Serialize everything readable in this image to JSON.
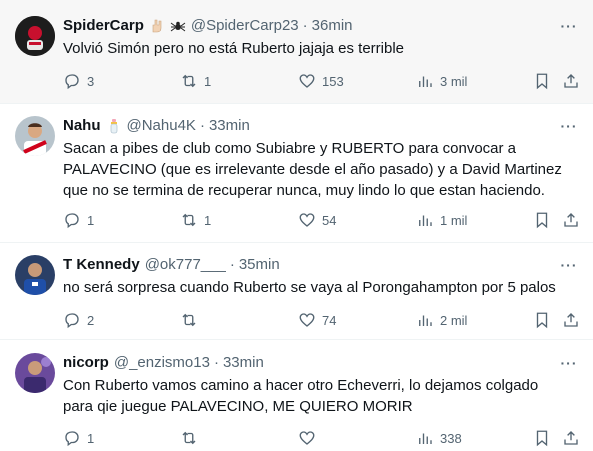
{
  "tweets": [
    {
      "name": "SpiderCarp",
      "handle": "@SpiderCarp23",
      "sep": "·",
      "time": "36min",
      "text": "Volvió Simón pero no está Ruberto jajaja es terrible",
      "replies": "3",
      "retweets": "1",
      "likes": "153",
      "views": "3 mil",
      "more": "···"
    },
    {
      "name": "Nahu",
      "handle": "@Nahu4K",
      "sep": "·",
      "time": "33min",
      "text": "Sacan a pibes de club como Subiabre y RUBERTO para convocar a\nPALAVECINO (que es irrelevante desde el año pasado) y a David Martinez\nque no se termina de recuperar nunca, muy lindo lo que estan haciendo.",
      "replies": "1",
      "retweets": "1",
      "likes": "54",
      "views": "1 mil",
      "more": "···"
    },
    {
      "name": "T Kennedy",
      "handle": "@ok777___",
      "sep": "·",
      "time": "35min",
      "text": "no será sorpresa cuando Ruberto se vaya al Porongahampton por 5 palos",
      "replies": "2",
      "retweets": "",
      "likes": "74",
      "views": "2 mil",
      "more": "···"
    },
    {
      "name": "nicorp",
      "handle": "@_enzismo13",
      "sep": "·",
      "time": "33min",
      "text": "Con Ruberto vamos camino a hacer otro Echeverri, lo dejamos colgado\npara qie juegue PALAVECINO, ME QUIERO MORIR",
      "replies": "1",
      "retweets": "",
      "likes": "",
      "views": "338",
      "more": "···"
    }
  ],
  "icons": {
    "reply": "reply-icon",
    "retweet": "retweet-icon",
    "like": "heart-icon",
    "views": "views-icon",
    "bookmark": "bookmark-icon",
    "share": "share-icon",
    "more": "more-icon"
  },
  "colors": {
    "text": "#0f1419",
    "secondary": "#536471",
    "divider": "#eff3f4",
    "highlight_bg": "#f7f7f7"
  }
}
